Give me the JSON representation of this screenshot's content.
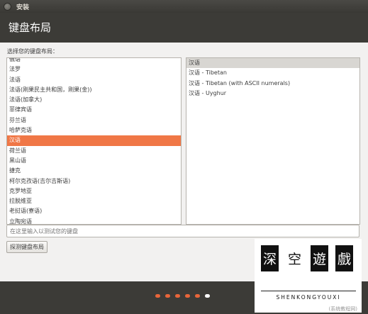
{
  "window": {
    "title": "安装"
  },
  "header": {
    "title": "键盘布局"
  },
  "layout_prompt": "选择您的键盘布局：",
  "layouts": [
    "俄语",
    "法罗",
    "法语",
    "法语(刚果民主共和国，刚果(金))",
    "法语(加拿大)",
    "菲律宾语",
    "芬兰语",
    "哈萨克语",
    "汉语",
    "荷兰语",
    "黑山语",
    "捷克",
    "柯尔克孜语(吉尔吉斯语)",
    "克罗地亚",
    "拉脱维亚",
    "老挝语(寮语)",
    "立陶宛语"
  ],
  "selected_layout": "汉语",
  "variants": [
    "汉语",
    "汉语 - Tibetan",
    "汉语 - Tibetan (with ASCII numerals)",
    "汉语 - Uyghur"
  ],
  "test_input": {
    "placeholder": "在这里输入以测试您的键盘",
    "value": ""
  },
  "detect_button": "探测键盘布局",
  "progress": {
    "total_steps": 6,
    "current_step": 6
  },
  "watermark": {
    "chars": [
      "深",
      "空",
      "遊",
      "戲"
    ],
    "brand": "SHENKONGYOUXI",
    "sub": "(系统教程网)"
  },
  "colors": {
    "accent": "#f07746",
    "panel": "#3c3b37",
    "content_bg": "#f2f1f0"
  }
}
